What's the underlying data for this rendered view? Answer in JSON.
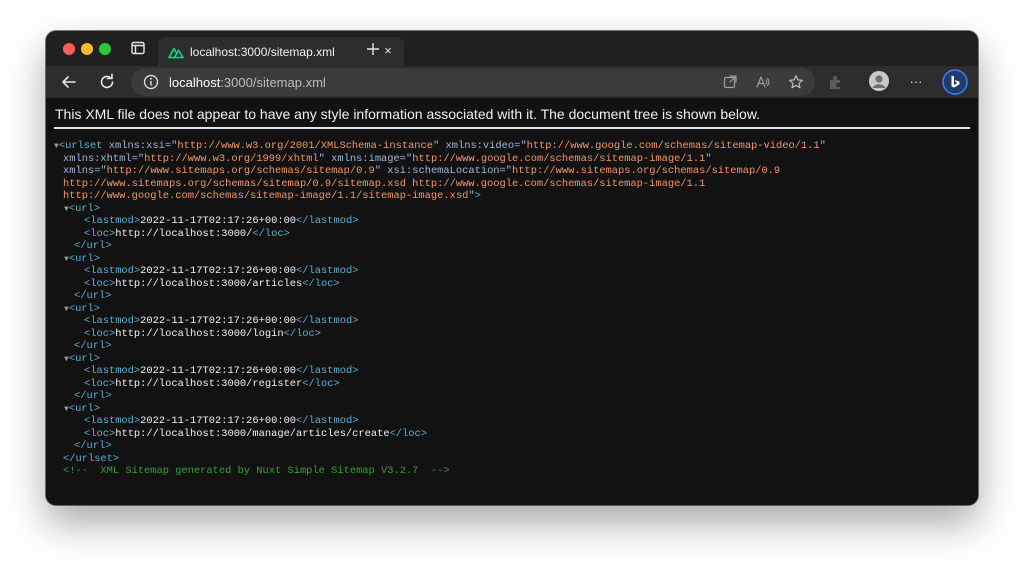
{
  "colors": {
    "window_bg": "#121212",
    "tab_active": "#2d2d2d",
    "xml_tag": "#5db0d7",
    "xml_attr_value": "#f29766",
    "xml_comment": "#35a135"
  },
  "tab": {
    "title": "localhost:3000/sitemap.xml",
    "favicon": "nuxt-icon",
    "close_glyph": "×"
  },
  "address_bar": {
    "host": "localhost",
    "path": ":3000/sitemap.xml"
  },
  "toolbar": {
    "more_glyph": "···"
  },
  "page": {
    "notice": "This XML file does not appear to have any style information associated with it. The document tree is shown below."
  },
  "xml": {
    "root_open_tag": "urlset",
    "root_close_tag": "urlset",
    "triangle": "▼",
    "namespaces": {
      "xsi_name": "xmlns:xsi",
      "xsi_value": "http://www.w3.org/2001/XMLSchema-instance",
      "video_name": "xmlns:video",
      "video_value": "http://www.google.com/schemas/sitemap-video/1.1",
      "xhtml_name": "xmlns:xhtml",
      "xhtml_value": "http://www.w3.org/1999/xhtml",
      "image_name": "xmlns:image",
      "image_value": "http://www.google.com/schemas/sitemap-image/1.1",
      "xmlns_name": "xmlns",
      "xmlns_value": "http://www.sitemaps.org/schemas/sitemap/0.9",
      "schema_name": "xsi:schemaLocation",
      "schema_value_line1": "http://www.sitemaps.org/schemas/sitemap/0.9",
      "schema_value_line2": "http://www.sitemaps.org/schemas/sitemap/0.9/sitemap.xsd http://www.google.com/schemas/sitemap-image/1.1",
      "schema_value_line3": "http://www.google.com/schemas/sitemap-image/1.1/sitemap-image.xsd"
    },
    "url_tag": "url",
    "lastmod_tag": "lastmod",
    "loc_tag": "loc",
    "urls": [
      {
        "lastmod": "2022-11-17T02:17:26+00:00",
        "loc": "http://localhost:3000/"
      },
      {
        "lastmod": "2022-11-17T02:17:26+00:00",
        "loc": "http://localhost:3000/articles"
      },
      {
        "lastmod": "2022-11-17T02:17:26+00:00",
        "loc": "http://localhost:3000/login"
      },
      {
        "lastmod": "2022-11-17T02:17:26+00:00",
        "loc": "http://localhost:3000/register"
      },
      {
        "lastmod": "2022-11-17T02:17:26+00:00",
        "loc": "http://localhost:3000/manage/articles/create"
      }
    ],
    "comment": "<!--  XML Sitemap generated by Nuxt Simple Sitemap V3.2.7  -->"
  }
}
